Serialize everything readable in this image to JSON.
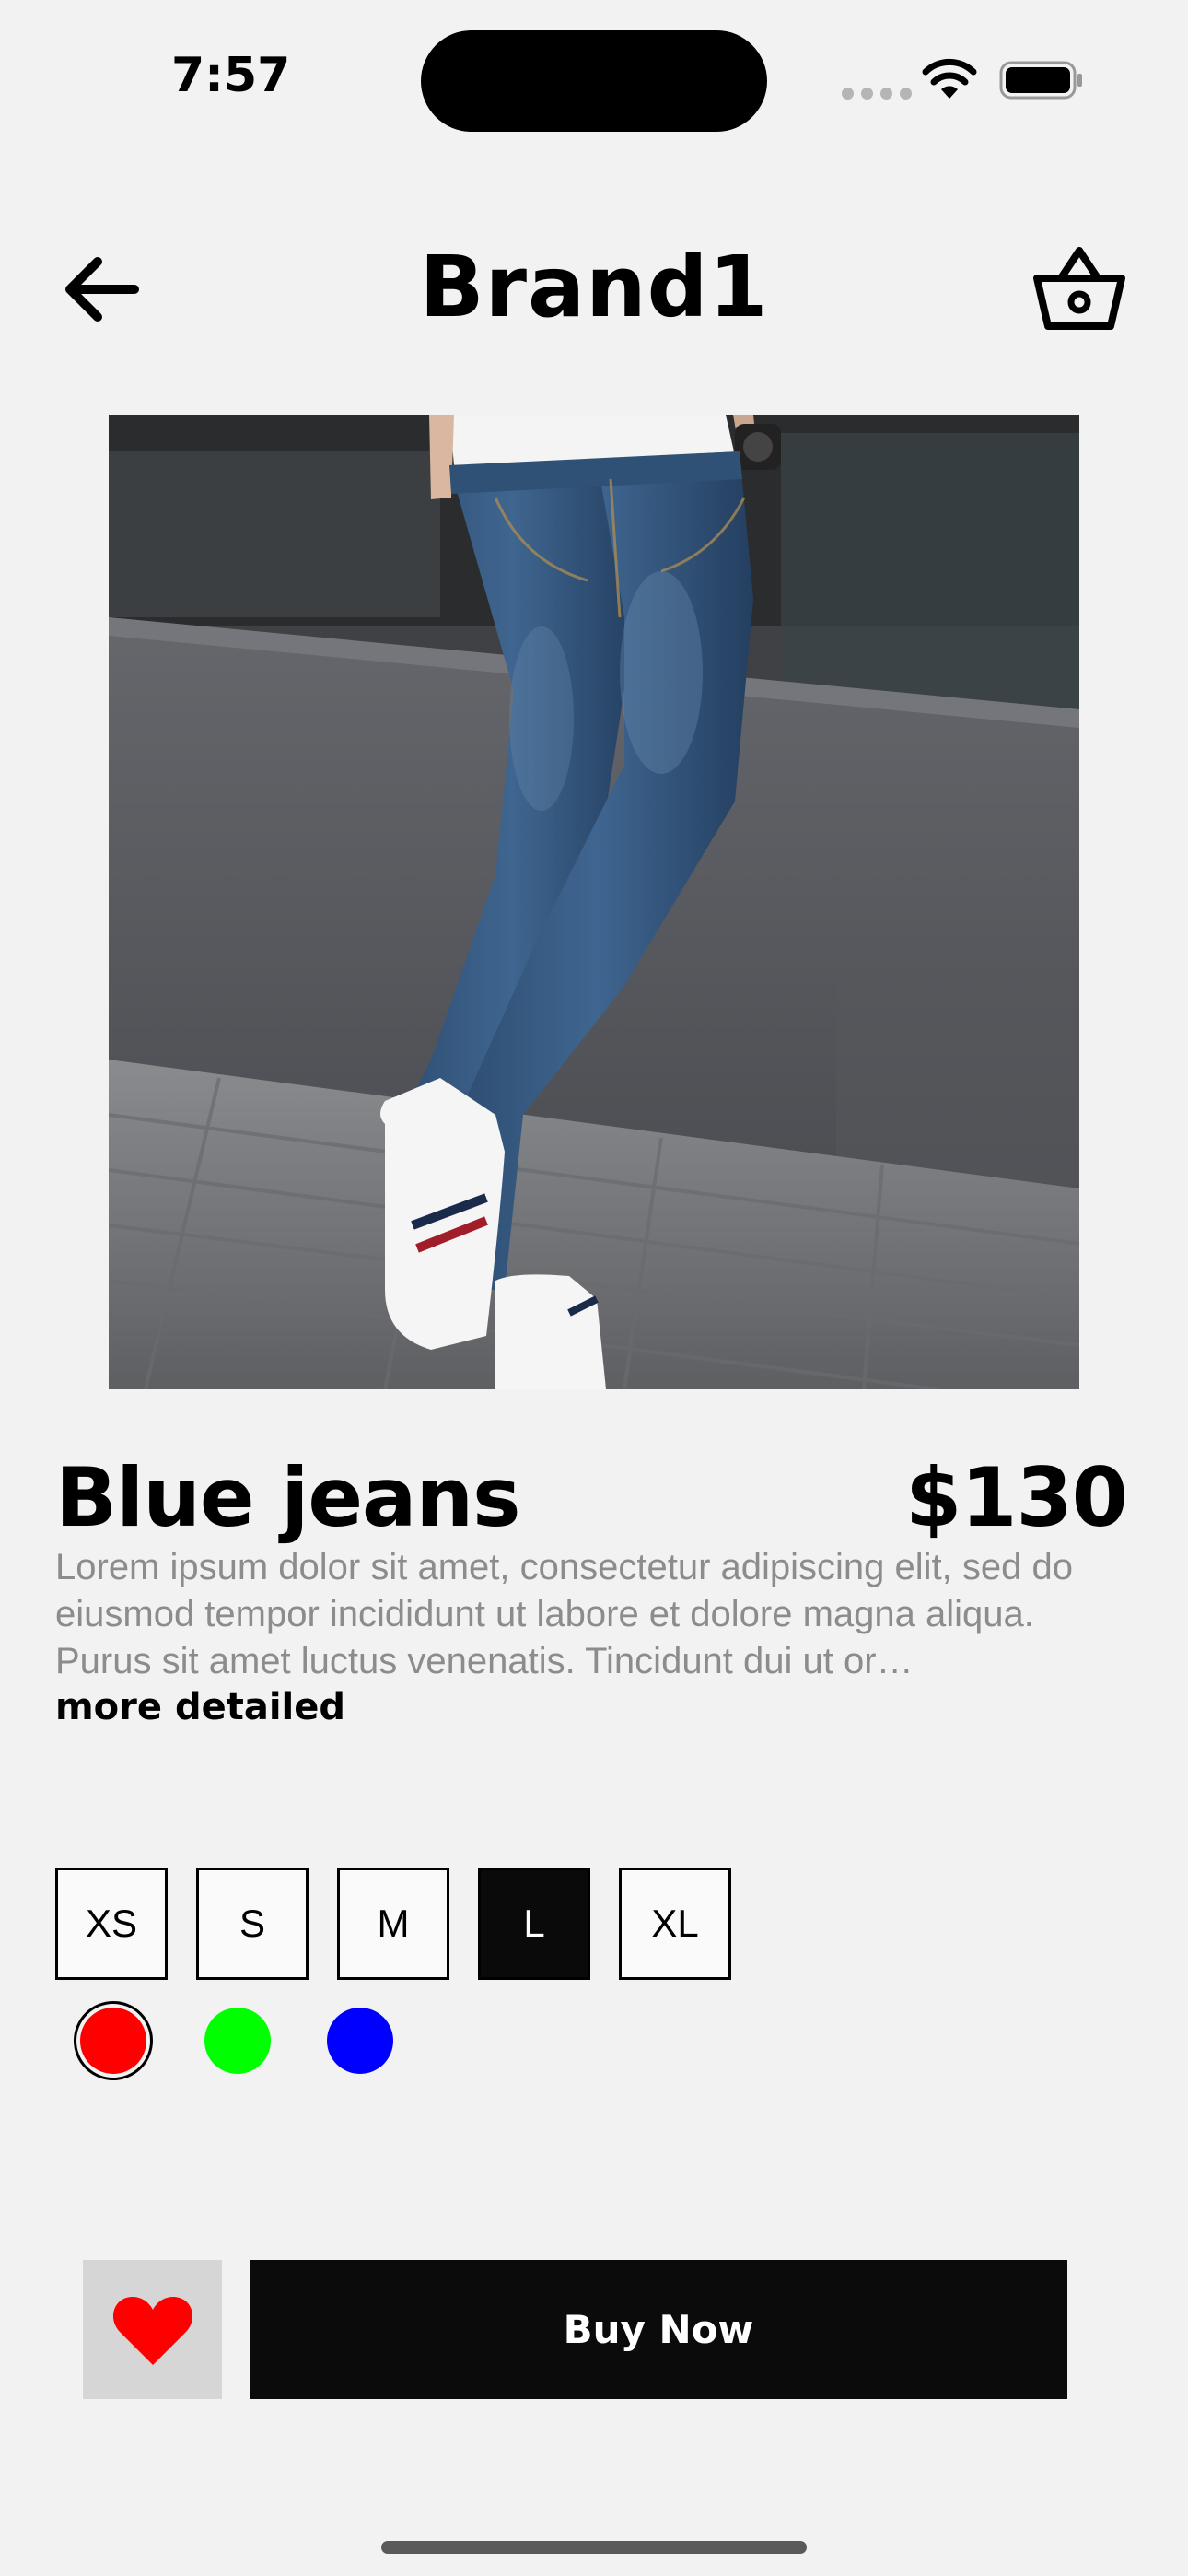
{
  "status_bar": {
    "time": "7:57"
  },
  "header": {
    "title": "Brand1",
    "back_icon": "arrow-left",
    "cart_icon": "basket"
  },
  "product": {
    "name": "Blue jeans",
    "price": "$130",
    "description": "Lorem ipsum dolor sit amet, consectetur adipiscing elit, sed do eiusmod tempor incididunt ut labore et dolore magna aliqua. Purus sit amet luctus venenatis. Tincidunt dui ut or…",
    "more_label": "more detailed"
  },
  "sizes": {
    "options": [
      "XS",
      "S",
      "M",
      "L",
      "XL"
    ],
    "selected": "L"
  },
  "colors": {
    "options": [
      "#ff0000",
      "#00ff00",
      "#0000ff"
    ],
    "selected": "#ff0000"
  },
  "actions": {
    "favorite_icon": "heart",
    "favorite_color": "#ff0000",
    "buy_label": "Buy Now"
  }
}
